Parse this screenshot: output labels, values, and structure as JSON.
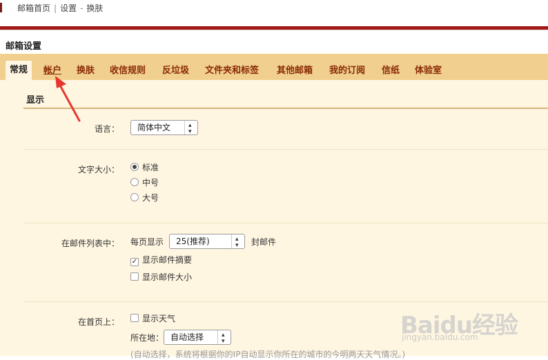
{
  "topnav": {
    "home": "邮箱首页",
    "sep": "|",
    "settings": "设置",
    "dash": "-",
    "skin": "换肤"
  },
  "page_title": "邮箱设置",
  "tabs": [
    {
      "label": "常规"
    },
    {
      "label": "帐户"
    },
    {
      "label": "换肤"
    },
    {
      "label": "收信规则"
    },
    {
      "label": "反垃圾"
    },
    {
      "label": "文件夹和标签"
    },
    {
      "label": "其他邮箱"
    },
    {
      "label": "我的订阅"
    },
    {
      "label": "信纸"
    },
    {
      "label": "体验室"
    }
  ],
  "display": {
    "section_title": "显示",
    "language": {
      "label": "语言：",
      "value": "简体中文"
    },
    "font_size": {
      "label": "文字大小：",
      "options": [
        "标准",
        "中号",
        "大号"
      ],
      "selected": "标准"
    },
    "mail_list": {
      "label": "在邮件列表中：",
      "per_page_prefix": "每页显示",
      "per_page_value": "25(推荐)",
      "per_page_suffix": "封邮件",
      "show_summary": {
        "label": "显示邮件摘要",
        "checked": true
      },
      "show_size": {
        "label": "显示邮件大小",
        "checked": false
      }
    },
    "home": {
      "label": "在首页上：",
      "show_weather": {
        "label": "显示天气",
        "checked": false
      },
      "location_label": "所在地：",
      "location_value": "自动选择",
      "hint": "(自动选择，系统将根据你的IP自动显示你所在的城市的今明两天天气情况。)"
    }
  },
  "watermark": {
    "logo": "Baidu经验",
    "url": "jingyan.baidu.com"
  },
  "colors": {
    "accent_red": "#a31818",
    "tab_bar": "#f0cf8f",
    "panel_bg": "#fff6e2",
    "tab_text": "#8a2a05",
    "arrow": "#e8362d"
  },
  "icons": [
    "check-icon",
    "annotation-arrow-icon"
  ]
}
